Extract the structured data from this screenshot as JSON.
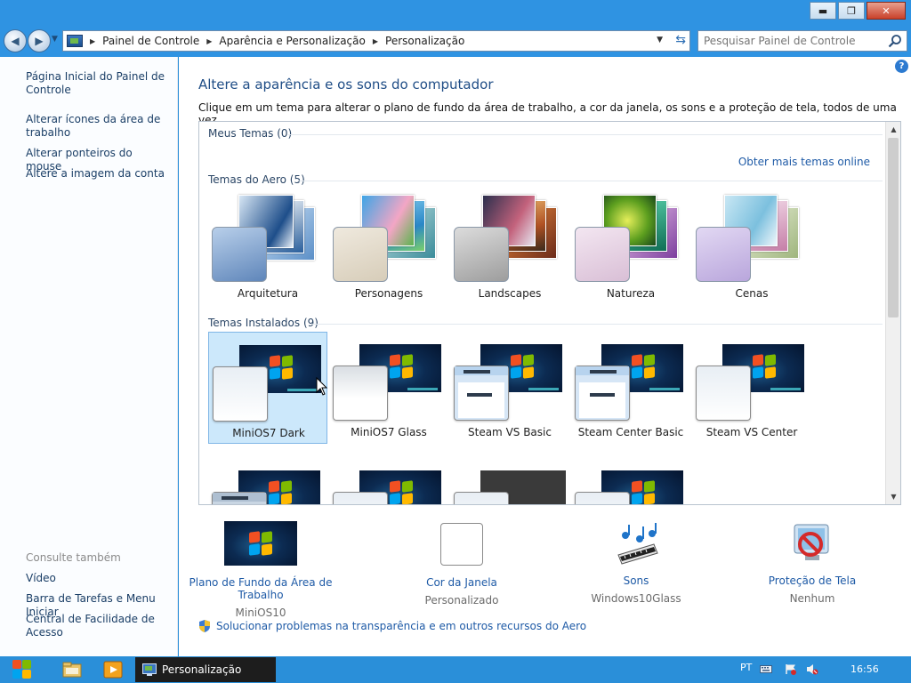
{
  "window": {
    "controls": {
      "minimize": "▬",
      "maximize": "❐",
      "close": "✕"
    }
  },
  "address": {
    "crumbs": [
      "Painel de Controle",
      "Aparência e Personalização",
      "Personalização"
    ]
  },
  "search": {
    "placeholder": "Pesquisar Painel de Controle"
  },
  "sidebar": {
    "links": [
      "Página Inicial do Painel de Controle",
      "Alterar ícones da área de trabalho",
      "Alterar ponteiros do mouse",
      "Altere a imagem da conta"
    ],
    "see_also_title": "Consulte também",
    "see_also": [
      "Vídeo",
      "Barra de Tarefas e Menu Iniciar",
      "Central de Facilidade de Acesso"
    ]
  },
  "main": {
    "help": "?",
    "title": "Altere a aparência e os sons do computador",
    "description": "Clique em um tema para alterar o plano de fundo da área de trabalho, a cor da janela, os sons e a proteção de tela, todos de uma vez.",
    "sections": {
      "my_themes": "Meus Temas (0)",
      "online_link": "Obter mais temas online",
      "aero_themes": "Temas do Aero (5)",
      "installed_themes": "Temas Instalados (9)"
    },
    "aero": [
      {
        "label": "Arquitetura"
      },
      {
        "label": "Personagens"
      },
      {
        "label": "Landscapes"
      },
      {
        "label": "Natureza"
      },
      {
        "label": "Cenas"
      }
    ],
    "installed": [
      {
        "label": "MiniOS7 Dark",
        "selected": true
      },
      {
        "label": "MiniOS7 Glass",
        "selected": false
      },
      {
        "label": "Steam VS Basic",
        "selected": false
      },
      {
        "label": "Steam Center Basic",
        "selected": false
      },
      {
        "label": "Steam VS Center",
        "selected": false
      }
    ]
  },
  "bottom": {
    "tiles": [
      {
        "link": "Plano de Fundo da Área de Trabalho",
        "value": "MiniOS10"
      },
      {
        "link": "Cor da Janela",
        "value": "Personalizado"
      },
      {
        "link": "Sons",
        "value": "Windows10Glass"
      },
      {
        "link": "Proteção de Tela",
        "value": "Nenhum"
      }
    ],
    "fix_link": "Solucionar problemas na transparência e em outros recursos do Aero"
  },
  "taskbar": {
    "task_label": "Personalização",
    "language": "PT",
    "clock": "16:56"
  },
  "colors": {
    "titlebar": "#2f93e2",
    "link": "#1e5aa6",
    "selection": "#cce8fb"
  }
}
